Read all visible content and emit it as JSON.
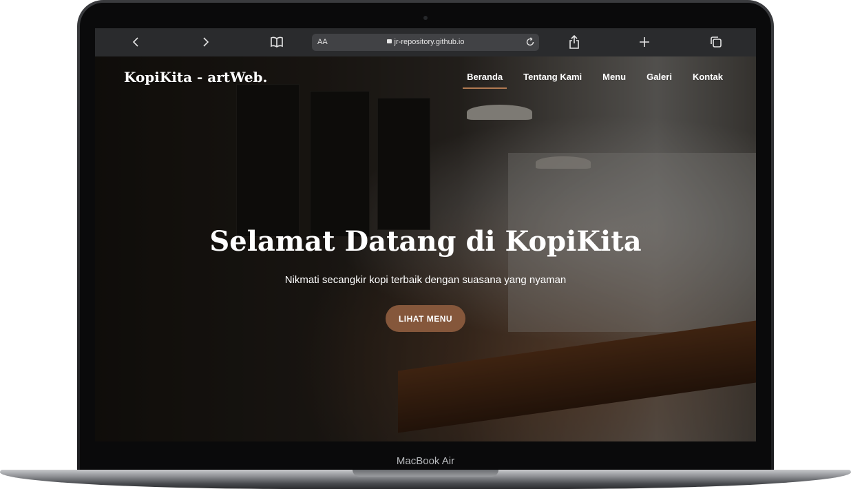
{
  "browser": {
    "text_size_label": "AA",
    "url": "jr-repository.github.io"
  },
  "site": {
    "logo": "KopiKita - artWeb.",
    "nav": [
      "Beranda",
      "Tentang Kami",
      "Menu",
      "Galeri",
      "Kontak"
    ],
    "active_nav": "Beranda"
  },
  "hero": {
    "headline": "Selamat Datang di KopiKita",
    "subtitle": "Nikmati secangkir kopi terbaik dengan suasana yang nyaman",
    "cta": "LIHAT MENU"
  },
  "device": {
    "label": "MacBook Air"
  }
}
